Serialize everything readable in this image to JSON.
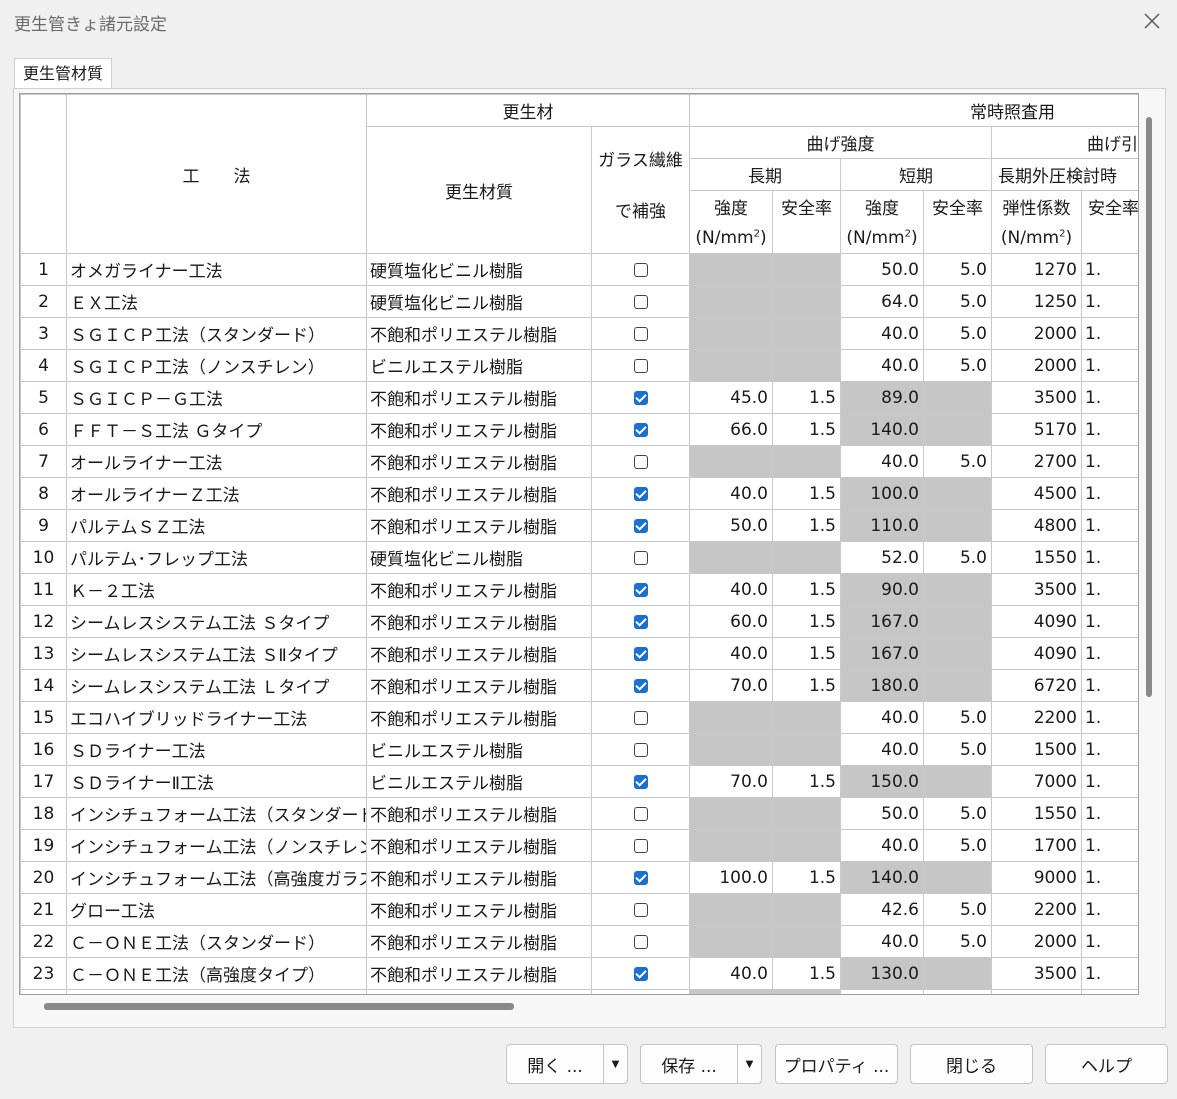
{
  "window": {
    "title": "更生管きょ諸元設定"
  },
  "tabs": [
    {
      "label": "更生管材質"
    }
  ],
  "headers": {
    "kouhou": "工　　法",
    "kouseizai": "更生材",
    "joji": "常時照査用",
    "kouseizaishitsu": "更生材質",
    "glass_1": "ガラス繊維",
    "glass_2": "で補強",
    "mage_kyodo": "曲げ強度",
    "mage_cut": "曲げ引",
    "choki": "長期",
    "tanki": "短期",
    "choki_gaiatsu": "長期外圧検討時",
    "kyodo": "強度",
    "anzenritsu": "安全率",
    "anzenritsu_cut": "安全率",
    "danseikeisu": "弾性係数",
    "unit_pre": "(N/mm",
    "unit_sup": "2",
    "unit_post": ")"
  },
  "rows": [
    {
      "no": "1",
      "kouhou": "オメガライナー工法",
      "zaishitsu": "硬質塩化ビニル樹脂",
      "glass": false,
      "choki_kyodo": "",
      "choki_anzen": "",
      "tanki_kyodo": "50.0",
      "tanki_anzen": "5.0",
      "dansei": "1270",
      "anzen2": "1."
    },
    {
      "no": "2",
      "kouhou": "ＥＸ工法",
      "zaishitsu": "硬質塩化ビニル樹脂",
      "glass": false,
      "choki_kyodo": "",
      "choki_anzen": "",
      "tanki_kyodo": "64.0",
      "tanki_anzen": "5.0",
      "dansei": "1250",
      "anzen2": "1."
    },
    {
      "no": "3",
      "kouhou": "ＳＧＩＣＰ工法（スタンダード）",
      "zaishitsu": "不飽和ポリエステル樹脂",
      "glass": false,
      "choki_kyodo": "",
      "choki_anzen": "",
      "tanki_kyodo": "40.0",
      "tanki_anzen": "5.0",
      "dansei": "2000",
      "anzen2": "1."
    },
    {
      "no": "4",
      "kouhou": "ＳＧＩＣＰ工法（ノンスチレン）",
      "zaishitsu": "ビニルエステル樹脂",
      "glass": false,
      "choki_kyodo": "",
      "choki_anzen": "",
      "tanki_kyodo": "40.0",
      "tanki_anzen": "5.0",
      "dansei": "2000",
      "anzen2": "1."
    },
    {
      "no": "5",
      "kouhou": "ＳＧＩＣＰ－Ｇ工法",
      "zaishitsu": "不飽和ポリエステル樹脂",
      "glass": true,
      "choki_kyodo": "45.0",
      "choki_anzen": "1.5",
      "tanki_kyodo": "89.0",
      "tanki_anzen": "",
      "dansei": "3500",
      "anzen2": "1."
    },
    {
      "no": "6",
      "kouhou": "ＦＦＴ－Ｓ工法 Ｇタイプ",
      "zaishitsu": "不飽和ポリエステル樹脂",
      "glass": true,
      "choki_kyodo": "66.0",
      "choki_anzen": "1.5",
      "tanki_kyodo": "140.0",
      "tanki_anzen": "",
      "dansei": "5170",
      "anzen2": "1."
    },
    {
      "no": "7",
      "kouhou": "オールライナー工法",
      "zaishitsu": "不飽和ポリエステル樹脂",
      "glass": false,
      "choki_kyodo": "",
      "choki_anzen": "",
      "tanki_kyodo": "40.0",
      "tanki_anzen": "5.0",
      "dansei": "2700",
      "anzen2": "1."
    },
    {
      "no": "8",
      "kouhou": "オールライナーＺ工法",
      "zaishitsu": "不飽和ポリエステル樹脂",
      "glass": true,
      "choki_kyodo": "40.0",
      "choki_anzen": "1.5",
      "tanki_kyodo": "100.0",
      "tanki_anzen": "",
      "dansei": "4500",
      "anzen2": "1."
    },
    {
      "no": "9",
      "kouhou": "パルテムＳＺ工法",
      "zaishitsu": "不飽和ポリエステル樹脂",
      "glass": true,
      "choki_kyodo": "50.0",
      "choki_anzen": "1.5",
      "tanki_kyodo": "110.0",
      "tanki_anzen": "",
      "dansei": "4800",
      "anzen2": "1."
    },
    {
      "no": "10",
      "kouhou": "パルテム･フレップ工法",
      "zaishitsu": "硬質塩化ビニル樹脂",
      "glass": false,
      "choki_kyodo": "",
      "choki_anzen": "",
      "tanki_kyodo": "52.0",
      "tanki_anzen": "5.0",
      "dansei": "1550",
      "anzen2": "1."
    },
    {
      "no": "11",
      "kouhou": "Ｋ－２工法",
      "zaishitsu": "不飽和ポリエステル樹脂",
      "glass": true,
      "choki_kyodo": "40.0",
      "choki_anzen": "1.5",
      "tanki_kyodo": "90.0",
      "tanki_anzen": "",
      "dansei": "3500",
      "anzen2": "1."
    },
    {
      "no": "12",
      "kouhou": "シームレスシステム工法 Ｓタイプ",
      "zaishitsu": "不飽和ポリエステル樹脂",
      "glass": true,
      "choki_kyodo": "60.0",
      "choki_anzen": "1.5",
      "tanki_kyodo": "167.0",
      "tanki_anzen": "",
      "dansei": "4090",
      "anzen2": "1."
    },
    {
      "no": "13",
      "kouhou": "シームレスシステム工法 ＳⅡタイプ",
      "zaishitsu": "不飽和ポリエステル樹脂",
      "glass": true,
      "choki_kyodo": "40.0",
      "choki_anzen": "1.5",
      "tanki_kyodo": "167.0",
      "tanki_anzen": "",
      "dansei": "4090",
      "anzen2": "1."
    },
    {
      "no": "14",
      "kouhou": "シームレスシステム工法 Ｌタイプ",
      "zaishitsu": "不飽和ポリエステル樹脂",
      "glass": true,
      "choki_kyodo": "70.0",
      "choki_anzen": "1.5",
      "tanki_kyodo": "180.0",
      "tanki_anzen": "",
      "dansei": "6720",
      "anzen2": "1."
    },
    {
      "no": "15",
      "kouhou": "エコハイブリッドライナー工法",
      "zaishitsu": "不飽和ポリエステル樹脂",
      "glass": false,
      "choki_kyodo": "",
      "choki_anzen": "",
      "tanki_kyodo": "40.0",
      "tanki_anzen": "5.0",
      "dansei": "2200",
      "anzen2": "1."
    },
    {
      "no": "16",
      "kouhou": "ＳＤライナー工法",
      "zaishitsu": "ビニルエステル樹脂",
      "glass": false,
      "choki_kyodo": "",
      "choki_anzen": "",
      "tanki_kyodo": "40.0",
      "tanki_anzen": "5.0",
      "dansei": "1500",
      "anzen2": "1."
    },
    {
      "no": "17",
      "kouhou": "ＳＤライナーⅡ工法",
      "zaishitsu": "ビニルエステル樹脂",
      "glass": true,
      "choki_kyodo": "70.0",
      "choki_anzen": "1.5",
      "tanki_kyodo": "150.0",
      "tanki_anzen": "",
      "dansei": "7000",
      "anzen2": "1."
    },
    {
      "no": "18",
      "kouhou": "インシチュフォーム工法（スタンダードＢ）",
      "zaishitsu": "不飽和ポリエステル樹脂",
      "glass": false,
      "choki_kyodo": "",
      "choki_anzen": "",
      "tanki_kyodo": "50.0",
      "tanki_anzen": "5.0",
      "dansei": "1550",
      "anzen2": "1."
    },
    {
      "no": "19",
      "kouhou": "インシチュフォーム工法（ノンスチレン）",
      "zaishitsu": "不飽和ポリエステル樹脂",
      "glass": false,
      "choki_kyodo": "",
      "choki_anzen": "",
      "tanki_kyodo": "40.0",
      "tanki_anzen": "5.0",
      "dansei": "1700",
      "anzen2": "1."
    },
    {
      "no": "20",
      "kouhou": "インシチュフォーム工法（高強度ガラス）",
      "zaishitsu": "不飽和ポリエステル樹脂",
      "glass": true,
      "choki_kyodo": "100.0",
      "choki_anzen": "1.5",
      "tanki_kyodo": "140.0",
      "tanki_anzen": "",
      "dansei": "9000",
      "anzen2": "1."
    },
    {
      "no": "21",
      "kouhou": "グロー工法",
      "zaishitsu": "不飽和ポリエステル樹脂",
      "glass": false,
      "choki_kyodo": "",
      "choki_anzen": "",
      "tanki_kyodo": "42.6",
      "tanki_anzen": "5.0",
      "dansei": "2200",
      "anzen2": "1."
    },
    {
      "no": "22",
      "kouhou": "Ｃ－ＯＮＥ工法（スタンダード）",
      "zaishitsu": "不飽和ポリエステル樹脂",
      "glass": false,
      "choki_kyodo": "",
      "choki_anzen": "",
      "tanki_kyodo": "40.0",
      "tanki_anzen": "5.0",
      "dansei": "2000",
      "anzen2": "1."
    },
    {
      "no": "23",
      "kouhou": "Ｃ－ＯＮＥ工法（高強度タイプ）",
      "zaishitsu": "不飽和ポリエステル樹脂",
      "glass": true,
      "choki_kyodo": "40.0",
      "choki_anzen": "1.5",
      "tanki_kyodo": "130.0",
      "tanki_anzen": "",
      "dansei": "3500",
      "anzen2": "1."
    }
  ],
  "buttons": {
    "open": "開く ...",
    "save": "保存 ...",
    "properties": "プロパティ ...",
    "close": "閉じる",
    "help": "ヘルプ"
  },
  "colors": {
    "shaded_cell": "#c6c6c6",
    "checkbox_checked": "#1a6fd1"
  }
}
